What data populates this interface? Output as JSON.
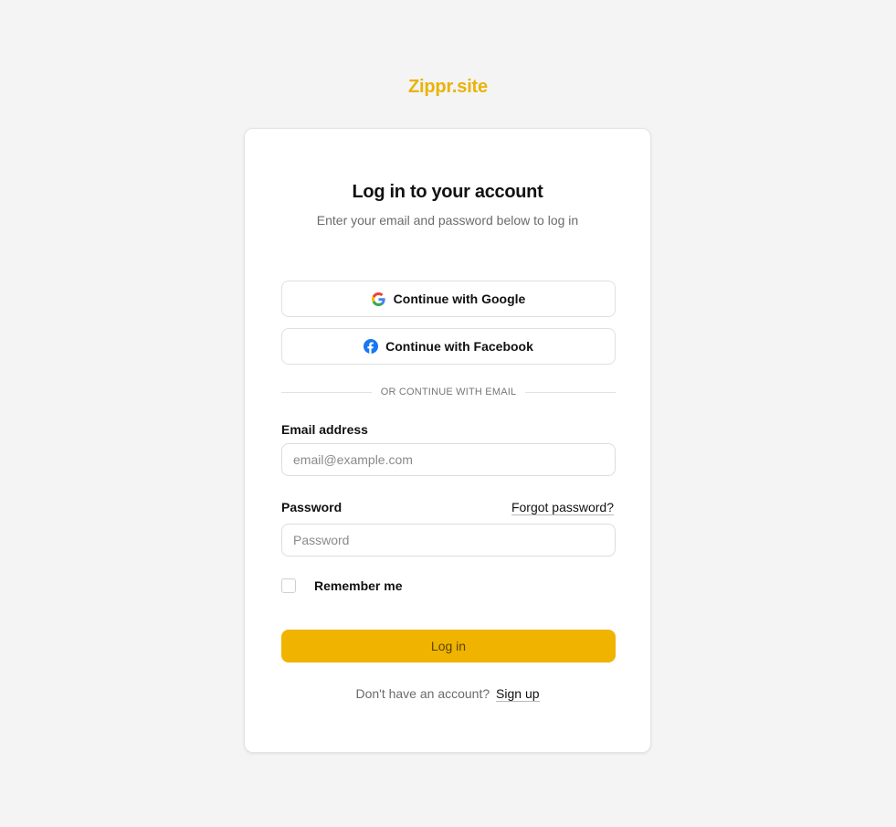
{
  "brand": {
    "name": "Zippr.site",
    "color": "#eab308"
  },
  "login": {
    "title": "Log in to your account",
    "subtitle": "Enter your email and password below to log in",
    "oauth": {
      "google_label": "Continue with Google",
      "google_icon": "google-icon",
      "facebook_label": "Continue with Facebook",
      "facebook_icon": "facebook-icon"
    },
    "divider_text": "OR CONTINUE WITH EMAIL",
    "email": {
      "label": "Email address",
      "placeholder": "email@example.com",
      "value": ""
    },
    "password": {
      "label": "Password",
      "placeholder": "Password",
      "value": "",
      "forgot_label": "Forgot password?"
    },
    "remember": {
      "label": "Remember me",
      "checked": false
    },
    "submit_label": "Log in",
    "submit_color": "#f0b400",
    "signup": {
      "prompt": "Don't have an account?",
      "link_label": "Sign up"
    }
  }
}
